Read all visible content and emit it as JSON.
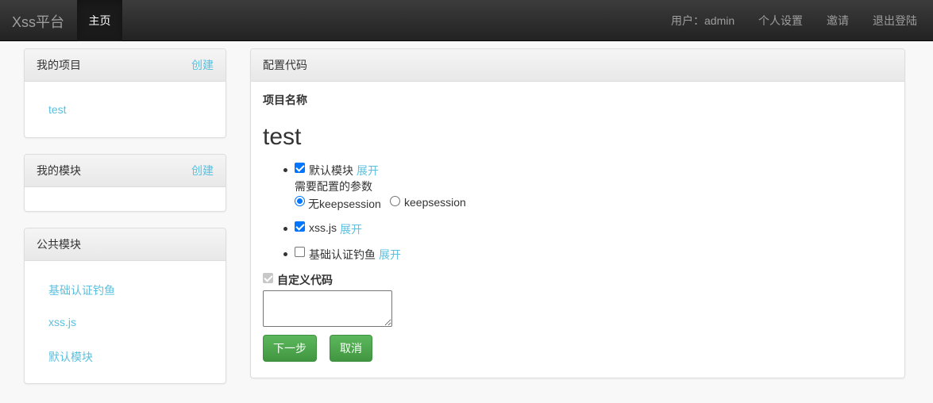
{
  "navbar": {
    "brand": "Xss平台",
    "home": "主页",
    "user": "用户：admin",
    "settings": "个人设置",
    "invite": "邀请",
    "logout": "退出登陆"
  },
  "sidebar": {
    "projects": {
      "title": "我的项目",
      "create": "创建",
      "items": [
        "test"
      ]
    },
    "modules": {
      "title": "我的模块",
      "create": "创建",
      "items": []
    },
    "public": {
      "title": "公共模块",
      "items": [
        "基础认证钓鱼",
        "xss.js",
        "默认模块"
      ]
    }
  },
  "config": {
    "title": "配置代码",
    "project_label": "项目名称",
    "project_name": "test",
    "modules": [
      {
        "name": "默认模块",
        "checked": true,
        "expand": "展开"
      },
      {
        "name": "xss.js",
        "checked": true,
        "expand": "展开"
      },
      {
        "name": "基础认证钓鱼",
        "checked": false,
        "expand": "展开"
      }
    ],
    "params_label": "需要配置的参数",
    "radio_options": [
      {
        "label": "无keepsession",
        "checked": true
      },
      {
        "label": "keepsession",
        "checked": false
      }
    ],
    "custom_code_label": "自定义代码",
    "custom_code_value": "",
    "next_button": "下一步",
    "cancel_button": "取消"
  }
}
